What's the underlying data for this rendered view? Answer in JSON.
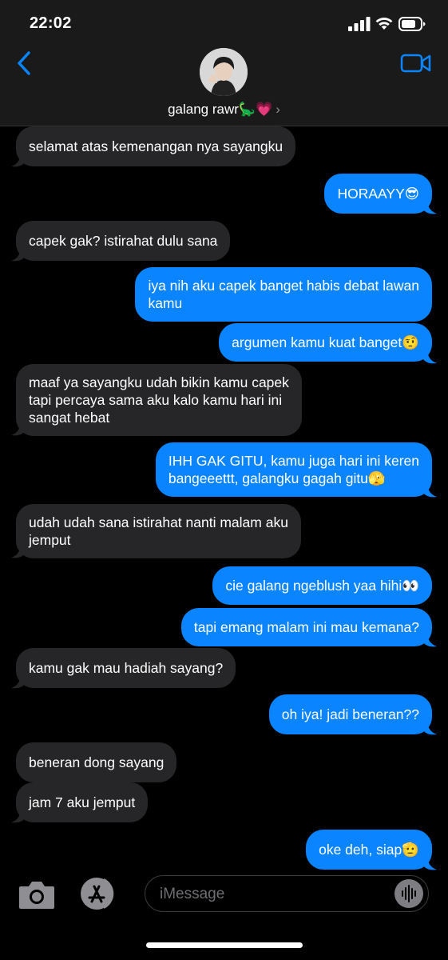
{
  "status_bar": {
    "time": "22:02"
  },
  "header": {
    "contact_name": "galang rawr🦕💗",
    "chevron": "›"
  },
  "messages": [
    {
      "side": "received",
      "lines": [
        "selamat atas kemenangan nya sayangku"
      ]
    },
    {
      "side": "sent",
      "lines": [
        "HORAAYY😎"
      ]
    },
    {
      "side": "received",
      "lines": [
        "capek gak? istirahat dulu sana"
      ]
    },
    {
      "side": "sent",
      "lines": [
        "iya nih aku capek banget habis debat lawan",
        "kamu"
      ]
    },
    {
      "side": "sent",
      "lines": [
        "argumen kamu kuat banget🤨"
      ]
    },
    {
      "side": "received",
      "lines": [
        "maaf ya sayangku udah bikin kamu capek",
        "tapi percaya sama aku kalo kamu hari ini",
        "sangat hebat"
      ]
    },
    {
      "side": "sent",
      "lines": [
        "IHH GAK GITU, kamu juga hari ini keren",
        "bangeeettt, galangku gagah gitu🫣"
      ]
    },
    {
      "side": "received",
      "lines": [
        "udah udah sana istirahat nanti malam aku",
        "jemput"
      ]
    },
    {
      "side": "sent",
      "lines": [
        "cie galang ngeblush yaa hihi👀"
      ]
    },
    {
      "side": "sent",
      "lines": [
        "tapi emang malam ini mau kemana?"
      ]
    },
    {
      "side": "received",
      "lines": [
        "kamu gak mau hadiah sayang?"
      ]
    },
    {
      "side": "sent",
      "lines": [
        "oh iya! jadi beneran??"
      ]
    },
    {
      "side": "received",
      "lines": [
        "beneran dong sayang"
      ]
    },
    {
      "side": "received",
      "lines": [
        "jam 7 aku jemput"
      ]
    },
    {
      "side": "sent",
      "lines": [
        "oke deh, siap🫡"
      ]
    }
  ],
  "input_bar": {
    "placeholder": "iMessage"
  },
  "colors": {
    "sent": "#0a84ff",
    "received": "#262628",
    "accent": "#0a84ff"
  },
  "icons": [
    "back-chevron-icon",
    "video-camera-icon",
    "camera-icon",
    "app-store-icon",
    "audio-waveform-icon"
  ]
}
